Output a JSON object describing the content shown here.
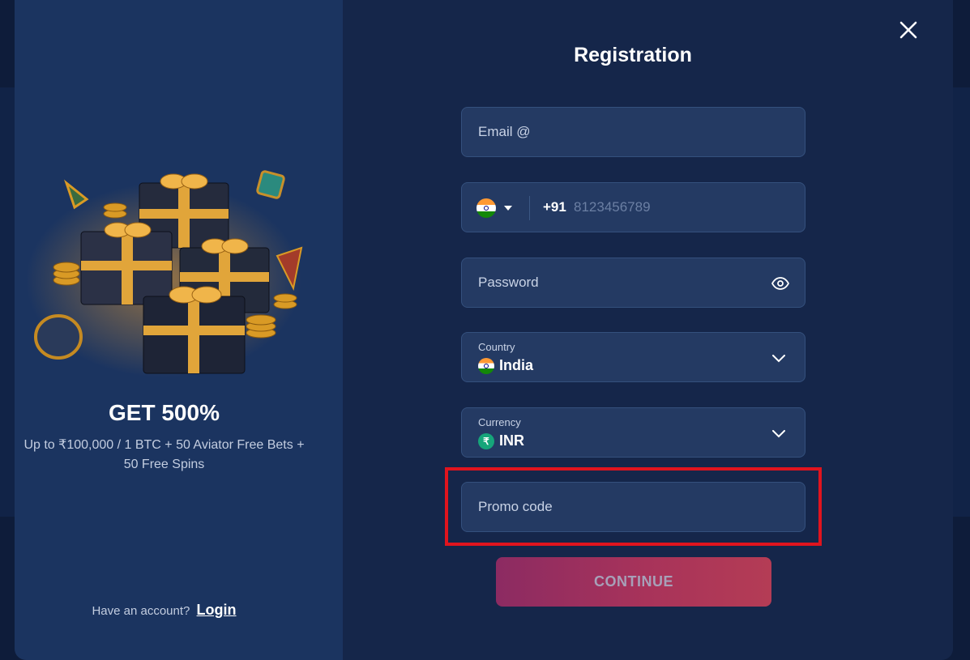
{
  "promo": {
    "headline": "GET 500%",
    "subline": "Up to ₹100,000 / 1 BTC + 50 Aviator Free Bets + 50 Free Spins",
    "have_account_text": "Have an account?",
    "login_label": "Login"
  },
  "form": {
    "title": "Registration",
    "email": {
      "placeholder": "Email @"
    },
    "phone": {
      "country_code": "+91",
      "placeholder": "8123456789",
      "flag_icon": "india-flag-icon"
    },
    "password": {
      "placeholder": "Password",
      "toggle_icon": "eye-icon"
    },
    "country": {
      "label": "Country",
      "value": "India"
    },
    "currency": {
      "label": "Currency",
      "value": "INR",
      "symbol": "₹"
    },
    "promo_code": {
      "placeholder": "Promo code"
    },
    "continue_label": "CONTINUE"
  },
  "colors": {
    "highlight": "#e0141e",
    "button_gradient_start": "#8c2b62",
    "button_gradient_end": "#b43c55",
    "panel_left": "#1b3460",
    "panel_right": "#15264a"
  }
}
